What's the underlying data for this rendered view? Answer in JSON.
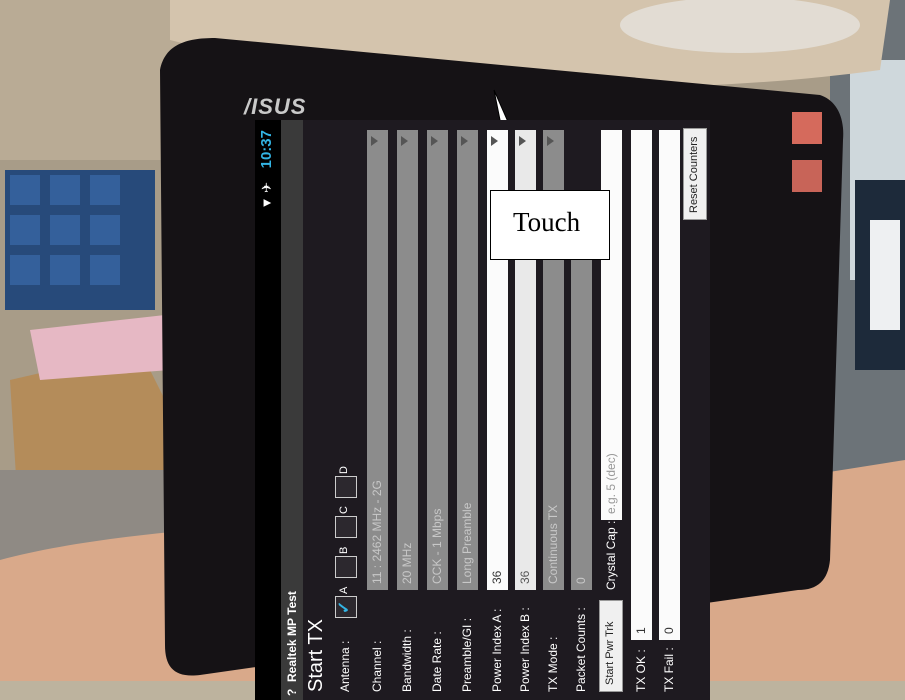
{
  "brand": {
    "logo": "/ISUS"
  },
  "callout": {
    "text": "Touch"
  },
  "status_bar": {
    "time": "10:37",
    "signal": "▼ ✈"
  },
  "app": {
    "title": "Realtek MP Test",
    "help_glyph": "?",
    "heading": "Start TX",
    "antenna": {
      "label": "Antenna :",
      "options": [
        "A",
        "B",
        "C",
        "D"
      ],
      "checked": "A"
    },
    "channel": {
      "label": "Channel :",
      "value": "11 : 2462 MHz - 2G"
    },
    "bandwidth": {
      "label": "Bandwidth :",
      "value": "20 MHz"
    },
    "data_rate": {
      "label": "Date Rate :",
      "value": "CCK - 1 Mbps"
    },
    "preamble": {
      "label": "Preamble/GI :",
      "value": "Long Preamble"
    },
    "power_a": {
      "label": "Power Index A :",
      "value": "36"
    },
    "power_b": {
      "label": "Power Index B :",
      "value": "36"
    },
    "tx_mode": {
      "label": "TX Mode :",
      "value": "Continuous TX"
    },
    "packet_counts": {
      "label": "Packet Counts :",
      "value": "0"
    },
    "start_pwr_trk": {
      "label": "Start Pwr Trk"
    },
    "crystal_cap": {
      "label": "Crystal Cap :",
      "placeholder": "e.g. 5 (dec)"
    },
    "tx_ok": {
      "label": "TX OK :",
      "value": "1"
    },
    "tx_fail": {
      "label": "TX Fail :",
      "value": "0"
    },
    "start_button": {
      "label": "TX"
    },
    "reset_button": {
      "label": "Reset Counters"
    }
  },
  "colors": {
    "accent": "#33b5e5",
    "panel": "#1e1a20"
  }
}
